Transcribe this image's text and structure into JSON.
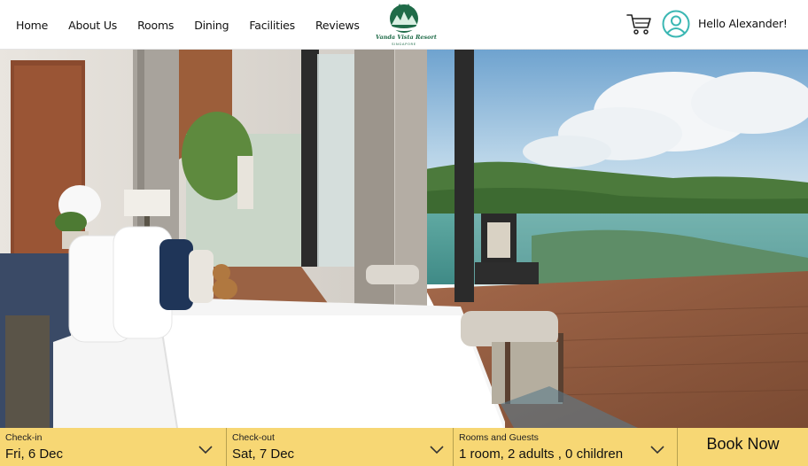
{
  "nav": {
    "items": [
      {
        "label": "Home"
      },
      {
        "label": "About Us"
      },
      {
        "label": "Rooms"
      },
      {
        "label": "Dining"
      },
      {
        "label": "Facilities"
      },
      {
        "label": "Reviews"
      }
    ]
  },
  "brand": {
    "logo_name": "Vanda Vista Resort",
    "logo_location": "SINGAPORE",
    "logo_color": "#1f6b48"
  },
  "user": {
    "greeting": "Hello Alexander!",
    "cart_icon": "cart-icon",
    "avatar_icon": "user-avatar-icon",
    "accent_color": "#3bb7b3"
  },
  "booking": {
    "bar_color": "#f7d774",
    "check_in": {
      "label": "Check-in",
      "value": "Fri, 6 Dec"
    },
    "check_out": {
      "label": "Check-out",
      "value": "Sat, 7 Dec"
    },
    "guests": {
      "label": "Rooms and Guests",
      "value": "1 room, 2 adults , 0 children"
    },
    "book_button": "Book Now"
  }
}
